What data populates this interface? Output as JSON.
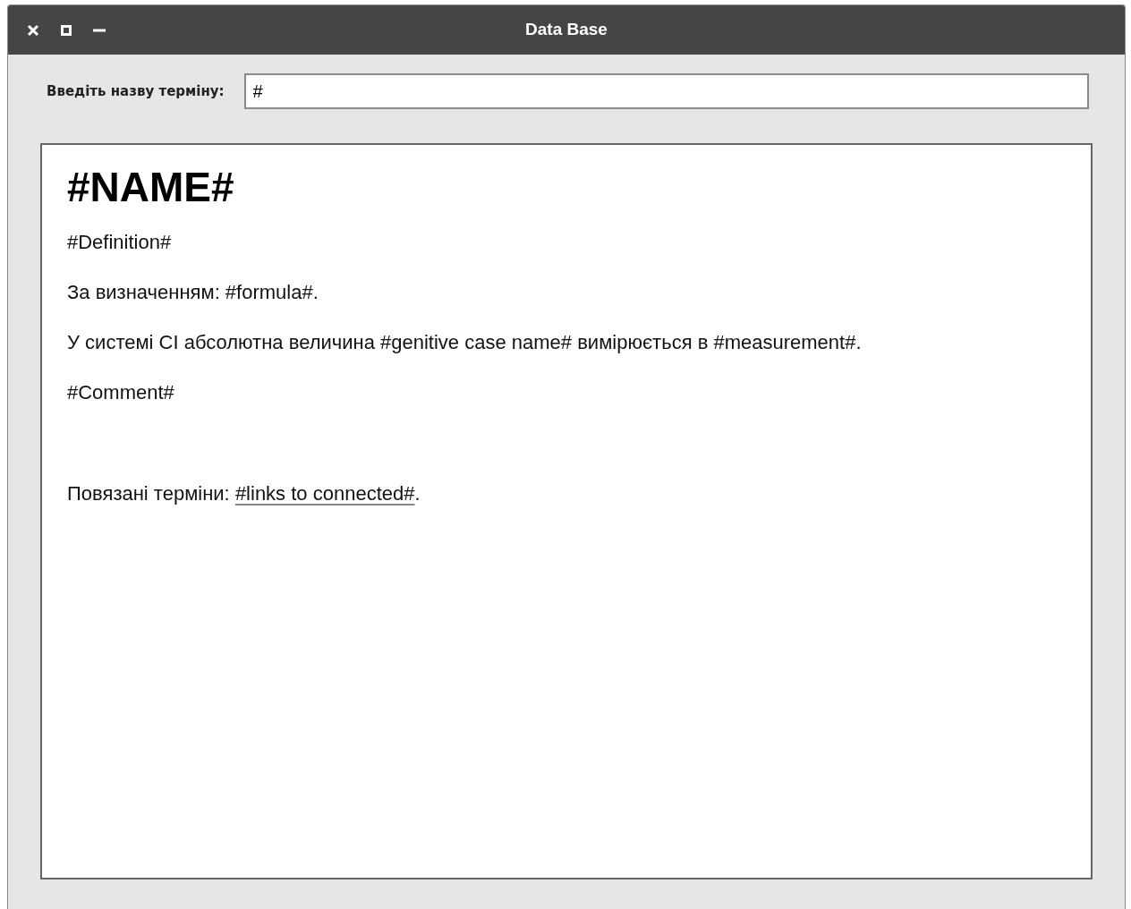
{
  "window": {
    "title": "Data Base",
    "buttons": [
      {
        "kind": "close"
      },
      {
        "kind": "maximize"
      },
      {
        "kind": "minimize"
      }
    ]
  },
  "search": {
    "label": "Введіть назву терміну:",
    "value": "#"
  },
  "article": {
    "heading": "#NAME#",
    "paragraphs": [
      "#Definition#",
      "За визначенням: #formula#.",
      "У системі СІ абсолютна величина #genitive case name# вимірюється в #measurement#.",
      "#Comment#"
    ],
    "related": {
      "label": "Повязані терміни:",
      "link": "#links to connected#",
      "suffix": "."
    }
  }
}
